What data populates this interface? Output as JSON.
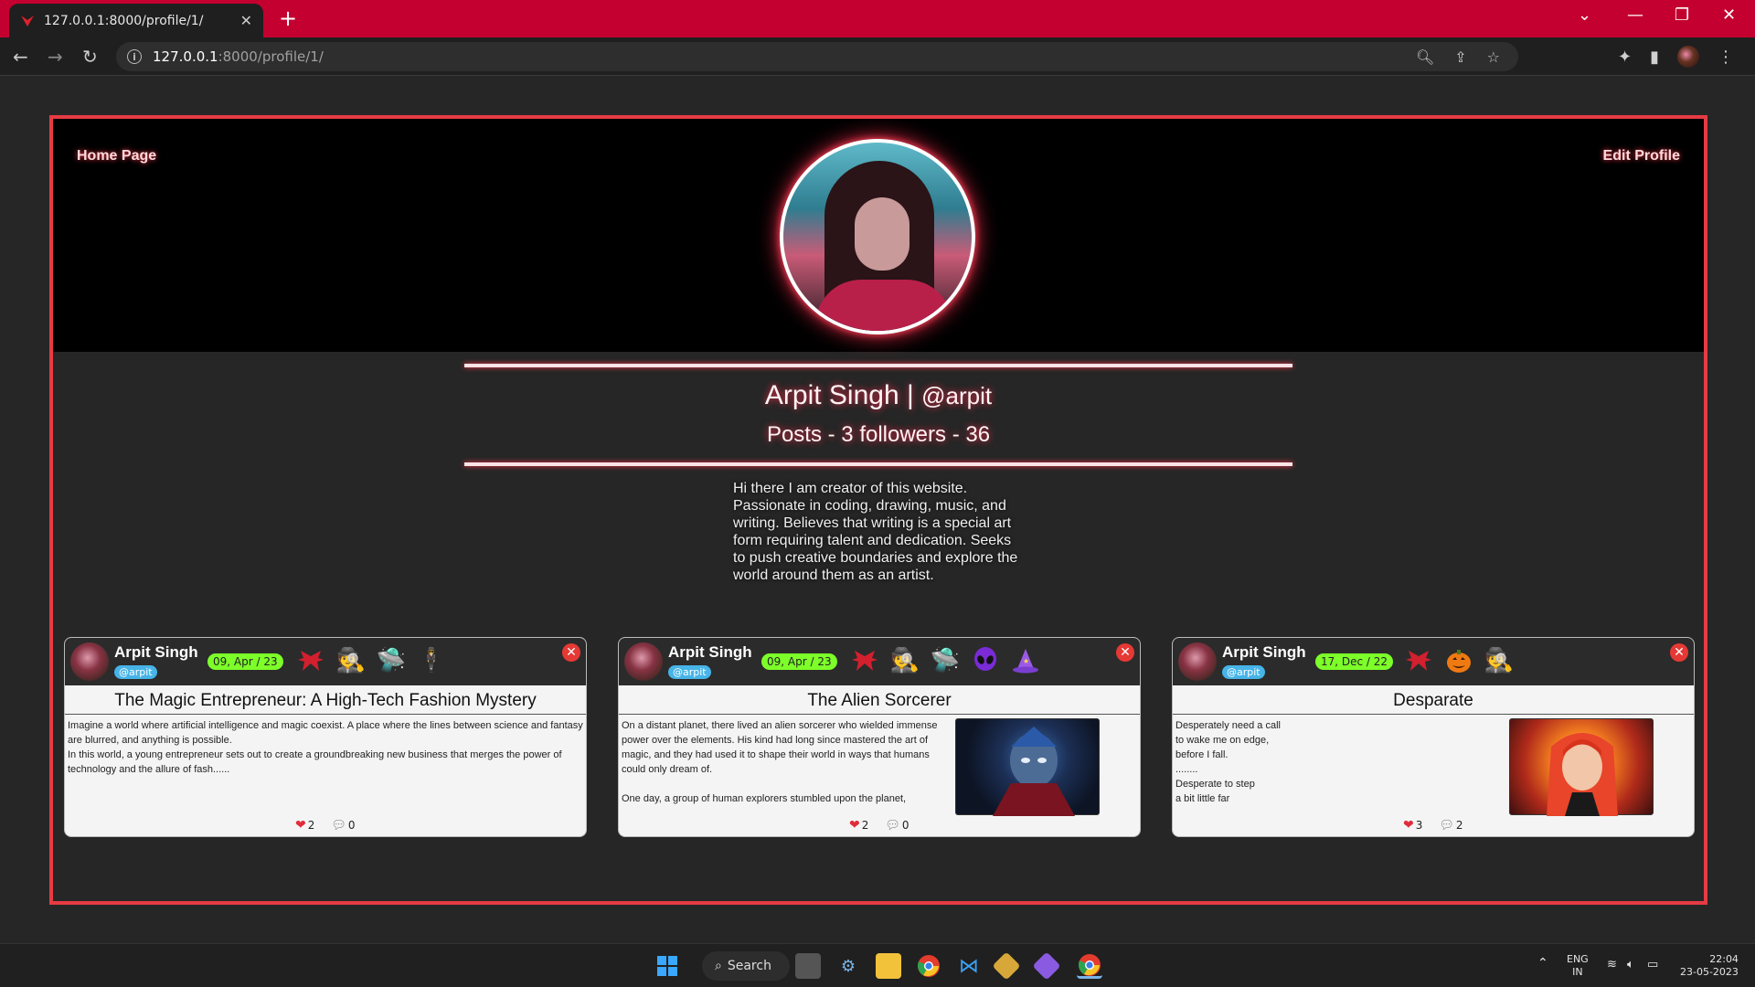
{
  "browser": {
    "tab_title": "127.0.0.1:8000/profile/1/",
    "tab_close": "✕",
    "new_tab": "+",
    "url_host": "127.0.0.1",
    "url_path": ":8000/profile/1/"
  },
  "profile": {
    "home_link": "Home Page",
    "edit_link": "Edit Profile",
    "name": "Arpit Singh |",
    "handle": "@arpit",
    "stats": "Posts - 3 followers - 36",
    "bio": "Hi there I am creator of this website. Passionate in coding, drawing, music, and writing. Believes that writing is a special art form requiring talent and dedication. Seeks to push creative boundaries and explore the world around them as an artist."
  },
  "posts": [
    {
      "author": "Arpit Singh",
      "handle": "@arpit",
      "date": "09, Apr / 23",
      "title": "The Magic Entrepreneur: A High-Tech Fashion Mystery",
      "body": "Imagine a world where artificial intelligence and magic coexist. A place where the lines between science and fantasy are blurred, and anything is possible.\nIn this world, a young entrepreneur sets out to create a groundbreaking new business that merges the power of technology and the allure of fash......",
      "likes": "2",
      "comments": "0",
      "tags": [
        "bat-icon",
        "detective-icon",
        "ufo-icon",
        "spy-icon"
      ]
    },
    {
      "author": "Arpit Singh",
      "handle": "@arpit",
      "date": "09, Apr / 23",
      "title": "The Alien Sorcerer",
      "body": "On a distant planet, there lived an alien sorcerer who wielded immense power over the elements. His kind had long since mastered the art of magic, and they had used it to shape their world in ways that humans could only dream of.\n\nOne day, a group of human explorers stumbled upon the planet,",
      "likes": "2",
      "comments": "0",
      "tags": [
        "bat-icon",
        "detective-icon",
        "ufo-icon",
        "alien-icon",
        "wizard-hat-icon"
      ]
    },
    {
      "author": "Arpit Singh",
      "handle": "@arpit",
      "date": "17, Dec / 22",
      "title": "Desparate",
      "body": "Desperately need a call\nto wake me on edge,\nbefore I fall.\n........\nDesperate to step\na bit little far",
      "likes": "3",
      "comments": "2",
      "tags": [
        "bat-icon",
        "pumpkin-icon",
        "detective-icon"
      ]
    }
  ],
  "taskbar": {
    "search_label": "Search",
    "lang": "ENG",
    "region": "IN",
    "time": "22:04",
    "date": "23-05-2023"
  }
}
